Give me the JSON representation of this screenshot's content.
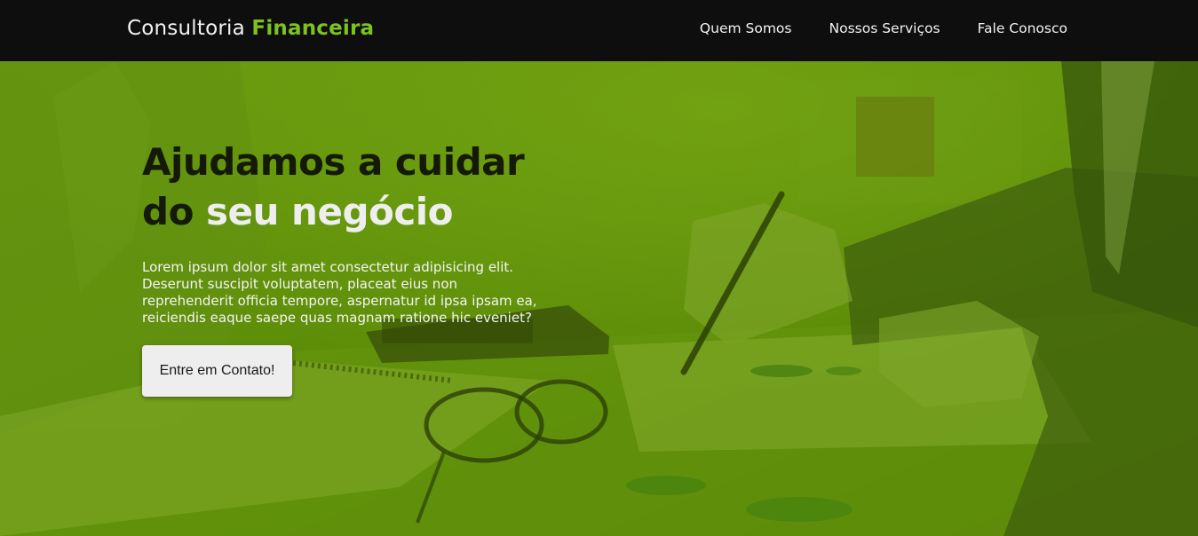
{
  "brand": {
    "prefix": "Consultoria",
    "accent": "Financeira",
    "accent_color": "#7ec21f"
  },
  "nav": {
    "items": [
      "Quem Somos",
      "Nossos Serviços",
      "Fale Conosco"
    ]
  },
  "hero": {
    "headline_line1": "Ajudamos a cuidar",
    "headline_line2_prefix": "do",
    "headline_line2_highlight": "seu negócio",
    "paragraph": "Lorem ipsum dolor sit amet consectetur adipisicing elit. Deserunt suscipit voluptatem, placeat eius non reprehenderit officia tempore, aspernatur id ipsa ipsam ea, reiciendis eaque saepe quas magnam ratione hic eveniet?",
    "cta_label": "Entre em Contato!",
    "overlay_color": "#5a8a06"
  }
}
